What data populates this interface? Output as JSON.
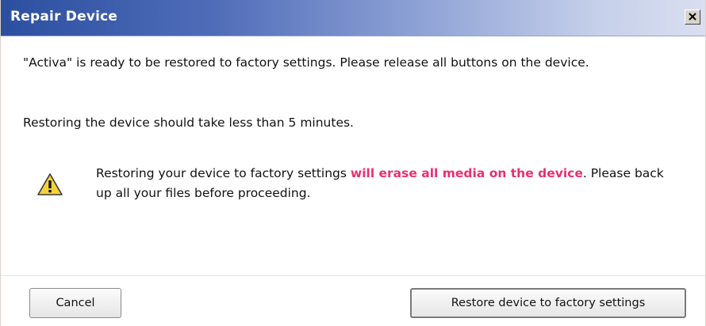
{
  "window": {
    "title": "Repair Device",
    "close_glyph": "✕"
  },
  "content": {
    "paragraph1": "\"Activa\" is ready to be restored to factory settings. Please release all buttons on the device.",
    "paragraph2": "Restoring the device should take less than 5 minutes.",
    "warning": {
      "icon": "warning-triangle-icon",
      "text_before": "Restoring your device to factory settings ",
      "text_emphasis": "will erase all media on the device",
      "text_after": ". Please back up all your files before proceeding."
    }
  },
  "buttons": {
    "cancel_label": "Cancel",
    "restore_label": "Restore device to factory settings"
  },
  "colors": {
    "emphasis": "#e8306d",
    "titlebar_start": "#2b4fa0",
    "titlebar_end": "#d9dff0"
  }
}
